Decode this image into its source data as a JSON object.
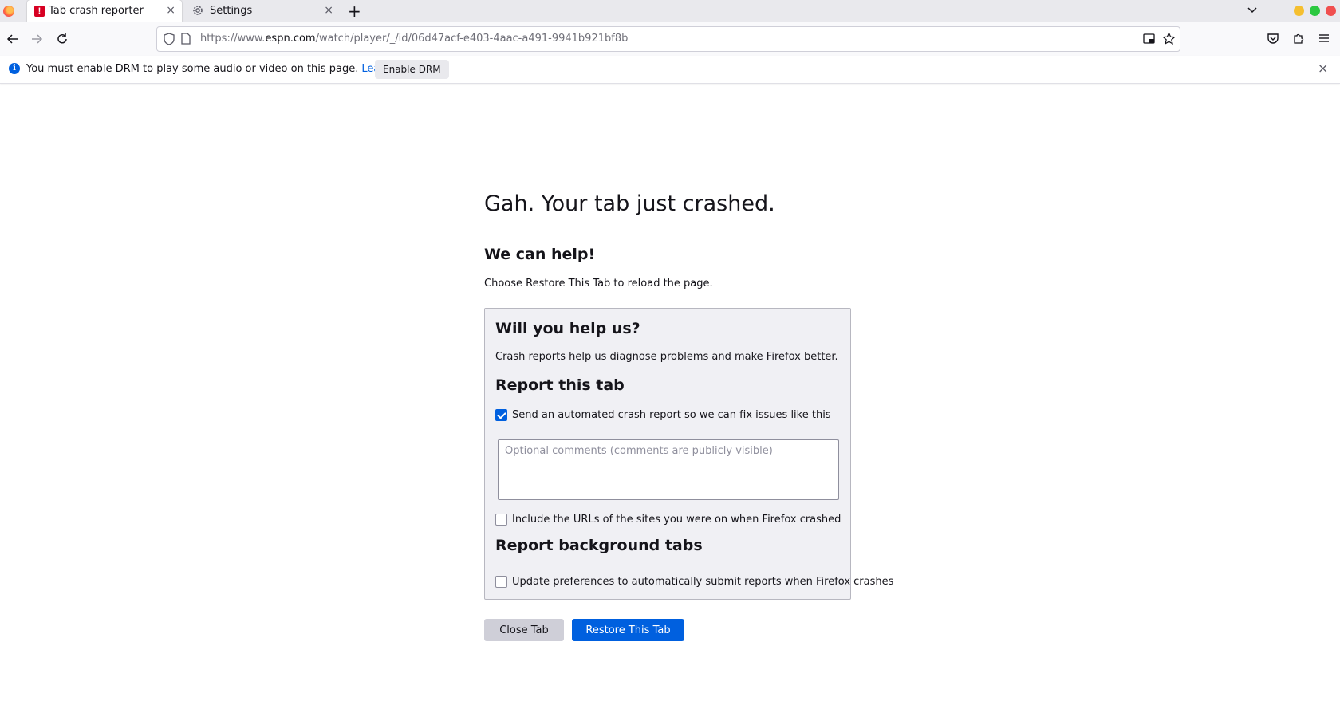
{
  "tabs": [
    {
      "label": "Tab crash reporter",
      "close": "×"
    },
    {
      "label": "Settings",
      "close": "×"
    }
  ],
  "new_tab": "+",
  "urlbar": {
    "prefix": "https://www.",
    "domain": "espn.com",
    "path": "/watch/player/_/id/06d47acf-e403-4aac-a491-9941b921bf8b"
  },
  "notification": {
    "message": "You must enable DRM to play some audio or video on this page.",
    "link": "Learn more",
    "button": "Enable DRM",
    "close": "×"
  },
  "page": {
    "title": "Gah. Your tab just crashed.",
    "subtitle": "We can help!",
    "instruction": "Choose Restore This Tab to reload the page."
  },
  "report_box": {
    "heading": "Will you help us?",
    "description": "Crash reports help us diagnose problems and make Firefox better.",
    "report_tab_heading": "Report this tab",
    "send_report_label": "Send an automated crash report so we can fix issues like this",
    "send_report_checked": true,
    "comments_placeholder": "Optional comments (comments are publicly visible)",
    "include_urls_label": "Include the URLs of the sites you were on when Firefox crashed",
    "include_urls_checked": false,
    "background_heading": "Report background tabs",
    "auto_submit_label": "Update preferences to automatically submit reports when Firefox crashes",
    "auto_submit_checked": false
  },
  "buttons": {
    "close_tab": "Close Tab",
    "restore_tab": "Restore This Tab"
  },
  "colors": {
    "accent": "#0060df",
    "crash_red": "#d70022",
    "window_min": "#f5bf2f",
    "window_max": "#2bc840",
    "window_close": "#f04f4f"
  }
}
